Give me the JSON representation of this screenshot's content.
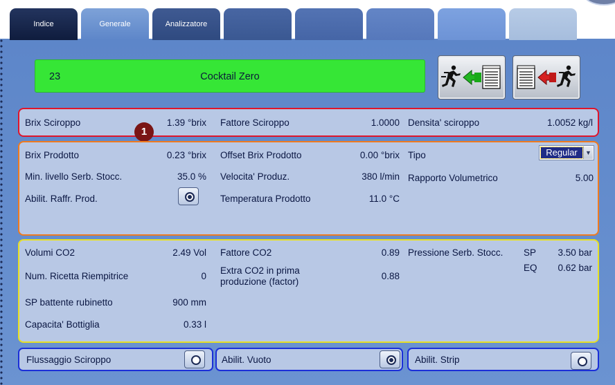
{
  "tabs": [
    {
      "label": "Indice"
    },
    {
      "label": "Generale"
    },
    {
      "label": "Analizzatore"
    },
    {
      "label": ""
    },
    {
      "label": ""
    },
    {
      "label": ""
    },
    {
      "label": ""
    },
    {
      "label": ""
    }
  ],
  "recipe": {
    "number": "23",
    "name": "Cocktail Zero",
    "color": "#36e636"
  },
  "actions": {
    "start_icon": "run-green-to-document-icon",
    "stop_icon": "document-red-to-run-icon"
  },
  "marker": "1",
  "syrup": {
    "brix_label": "Brix Sciroppo",
    "brix_value": "1.39 °brix",
    "factor_label": "Fattore Sciroppo",
    "factor_value": "1.0000",
    "density_label": "Densita' sciroppo",
    "density_value": "1.0052 kg/l"
  },
  "product": {
    "brix_label": "Brix Prodotto",
    "brix_value": "0.23 °brix",
    "offset_label": "Offset Brix Prodotto",
    "offset_value": "0.00 °brix",
    "type_label": "Tipo",
    "type_value": "Regular",
    "min_level_label": "Min. livello Serb. Stocc.",
    "min_level_value": "35.0 %",
    "speed_label": "Velocita' Produz.",
    "speed_value": "380 l/min",
    "ratio_label": "Rapporto Volumetrico",
    "ratio_value": "5.00",
    "cooling_label": "Abilit. Raffr. Prod.",
    "temp_label": "Temperatura Prodotto",
    "temp_value": "11.0 °C"
  },
  "co2": {
    "volumes_label": "Volumi CO2",
    "volumes_value": "2.49 Vol",
    "factor_label": "Fattore CO2",
    "factor_value": "0.89",
    "pressure_label": "Pressione Serb. Stocc.",
    "sp_label": "SP",
    "sp_value": "3.50 bar",
    "eq_label": "EQ",
    "eq_value": "0.62 bar",
    "filler_recipe_label": "Num. Ricetta Riempitrice",
    "filler_recipe_value": "0",
    "extra_label": "Extra CO2 in prima produzione (factor)",
    "extra_value": "0.88",
    "tap_label": "SP battente rubinetto",
    "tap_value": "900 mm",
    "bottle_label": "Capacita' Bottiglia",
    "bottle_value": "0.33 l"
  },
  "toggles": {
    "flush_label": "Flussaggio Sciroppo",
    "vacuum_label": "Abilit. Vuoto",
    "strip_label": "Abilit. Strip"
  },
  "colors": {
    "red_border": "#e0142a",
    "orange_border": "#f07a1e",
    "yellow_border": "#e8e024",
    "blue_border": "#1b2fd8"
  }
}
